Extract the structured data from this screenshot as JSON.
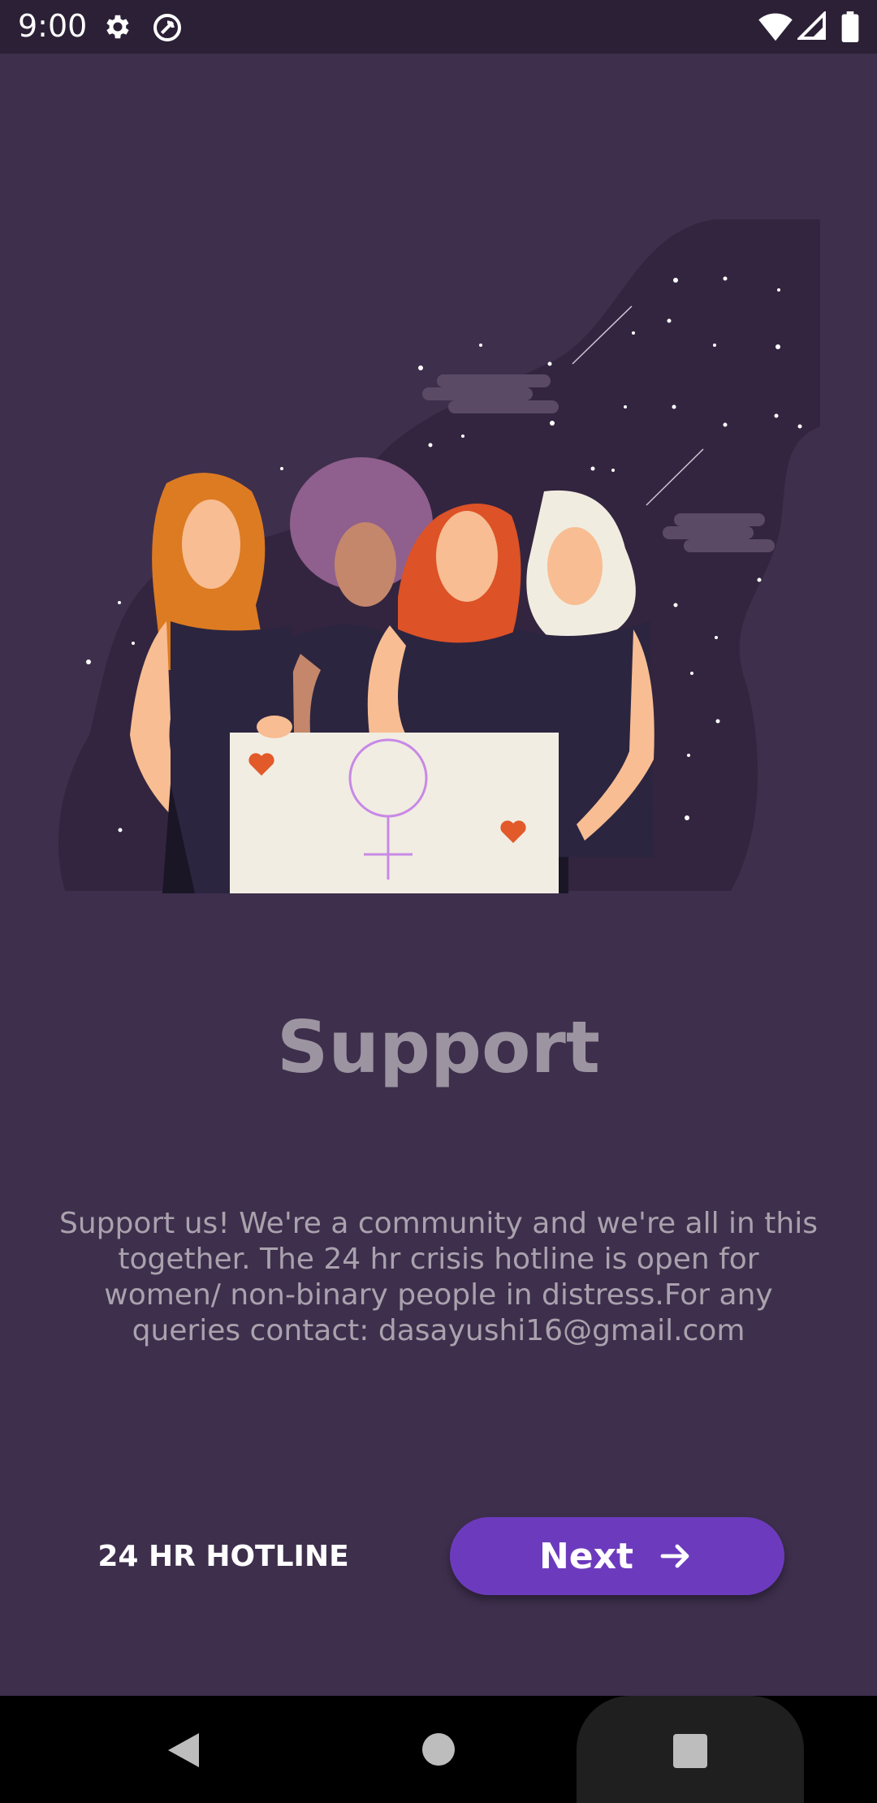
{
  "status_bar": {
    "time": "9:00",
    "icons": [
      "gear-icon",
      "vpn-icon",
      "wifi-icon",
      "signal-icon",
      "battery-icon"
    ]
  },
  "illustration": {
    "name": "four-women-holding-sign",
    "symbol": "female-symbol"
  },
  "main": {
    "title": "Support",
    "description": "Support us! We're a community and we're all in this together. The 24 hr crisis hotline is open for women/ non-binary people in distress.For any queries contact: dasayushi16@gmail.com"
  },
  "actions": {
    "hotline_label": "24 HR HOTLINE",
    "next_label": "Next",
    "next_icon": "arrow-right-icon"
  },
  "nav_bar": {
    "icons": [
      "back-icon",
      "home-icon",
      "recents-icon"
    ]
  },
  "colors": {
    "background": "#3e2f4d",
    "status_bar": "#2b2035",
    "accent": "#6c3bbd",
    "title": "#9c95a1",
    "body_text": "#a9a2ad"
  }
}
